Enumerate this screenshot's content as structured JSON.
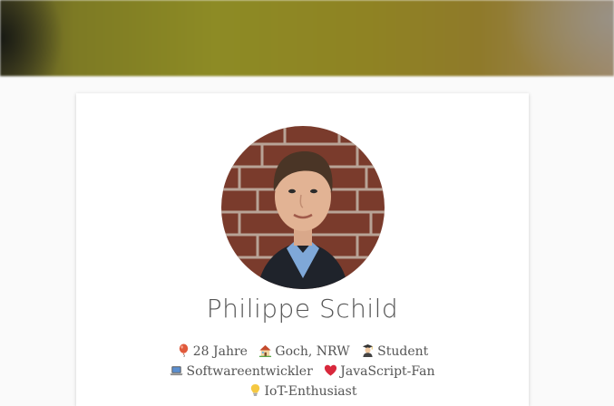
{
  "profile": {
    "name": "Philippe Schild",
    "facts": [
      {
        "icon": "balloon-icon",
        "text": "28 Jahre"
      },
      {
        "icon": "house-icon",
        "text": "Goch, NRW"
      },
      {
        "icon": "student-icon",
        "text": "Student"
      },
      {
        "icon": "laptop-icon",
        "text": "Softwareentwickler"
      },
      {
        "icon": "heart-icon",
        "text": "JavaScript-Fan"
      },
      {
        "icon": "lightbulb-icon",
        "text": "IoT-Enthusiast"
      }
    ]
  },
  "colors": {
    "page_background": "#fafafa",
    "card_background": "#ffffff",
    "text": "#555555",
    "hero_tint": "#8d8b25"
  }
}
